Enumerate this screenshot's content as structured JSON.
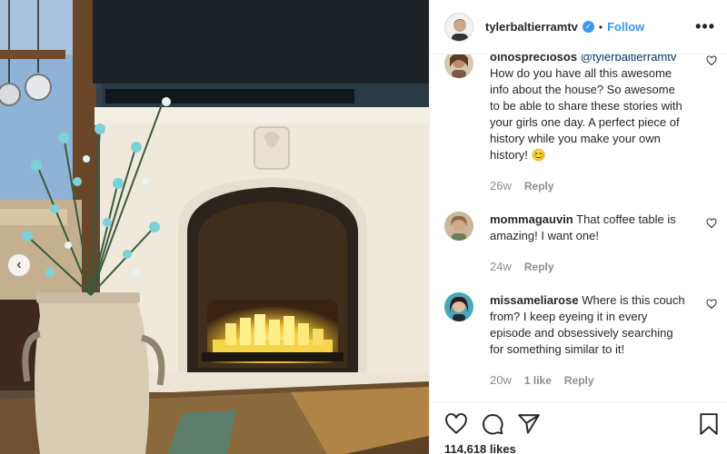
{
  "post": {
    "username": "tylerbaltierramtv",
    "follow_label": "Follow",
    "separator": "•",
    "more_label": "•••",
    "likes_count": "114,618 likes"
  },
  "comments": [
    {
      "username": "olnospreciosos",
      "mention": "@tylerbaltierramtv",
      "text": "How do you have all this awesome info about the house? So awesome to be able to share these stories with your girls one day. A perfect piece of history while you make your own history! 😊",
      "time": "26w",
      "reply_label": "Reply"
    },
    {
      "username": "mommagauvin",
      "text": "That coffee table is amazing! I want one!",
      "time": "24w",
      "reply_label": "Reply"
    },
    {
      "username": "missameliarose",
      "text": "Where is this couch from? I keep eyeing it in every episode and obsessively searching for something similar to it!",
      "time": "20w",
      "likes": "1 like",
      "reply_label": "Reply"
    }
  ],
  "icons": {
    "verified": "verified-badge-icon",
    "like": "heart-icon",
    "comment": "comment-icon",
    "share": "paper-plane-icon",
    "save": "bookmark-icon",
    "prev": "chevron-left-icon"
  },
  "colors": {
    "link_blue": "#3897f0",
    "text": "#262626",
    "muted": "#8e8e8e"
  }
}
